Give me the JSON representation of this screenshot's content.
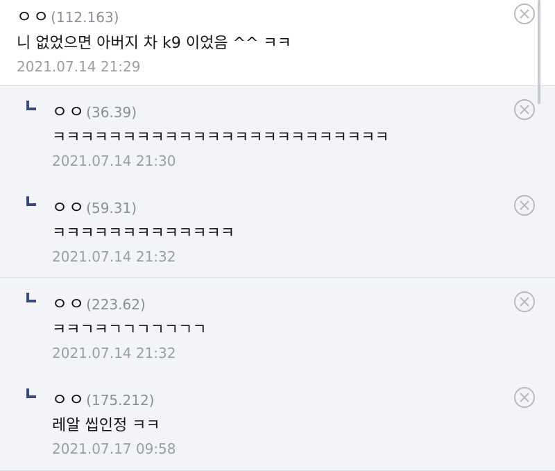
{
  "comments": [
    {
      "nickname": "ㅇㅇ",
      "ip": "(112.163)",
      "text": "니 없었으면 아버지 차 k9 이었음 ^^ ㅋㅋ",
      "date": "2021.07.14 21:29"
    },
    {
      "nickname": "ㅇㅇ",
      "ip": "(36.39)",
      "text": "ㅋㅋㅋㅋㅋㅋㅋㅋㅋㅋㅋㅋㅋㅋㅋㅋㅋㅋㅋㅋㅋㅋㅋㅋ",
      "date": "2021.07.14 21:30"
    },
    {
      "nickname": "ㅇㅇ",
      "ip": "(59.31)",
      "text": "ㅋㅋㅋㅋㅋㅋㅋㅋㅋㅋㅋㅋㅋ",
      "date": "2021.07.14 21:32"
    },
    {
      "nickname": "ㅇㅇ",
      "ip": "(223.62)",
      "text": "ㅋㅋㄱㅋㄱㄱㄱㄱㄱㄱㄱ",
      "date": "2021.07.14 21:32"
    },
    {
      "nickname": "ㅇㅇ",
      "ip": "(175.212)",
      "text": "레알 씹인정 ㅋㅋ",
      "date": "2021.07.17 09:58"
    }
  ],
  "icons": {
    "reply": "reply-arrow-icon",
    "delete": "close-circle-icon"
  },
  "colors": {
    "reply_background": "#f3f4f7",
    "reply_marker": "#3b4a7d",
    "meta_text": "#9b9ea5"
  }
}
